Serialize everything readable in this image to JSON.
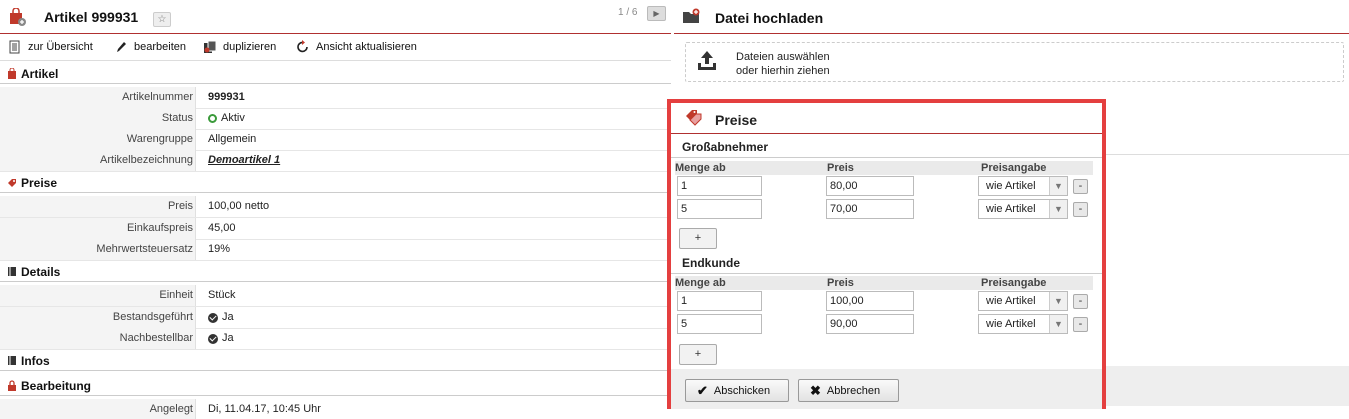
{
  "article": {
    "title": "Artikel 999931",
    "pager": "1 / 6",
    "toolbar": {
      "overview": "zur Übersicht",
      "edit": "bearbeiten",
      "duplicate": "duplizieren",
      "refresh": "Ansicht aktualisieren"
    },
    "sections": {
      "artikel": "Artikel",
      "preise": "Preise",
      "details": "Details",
      "infos": "Infos",
      "bearbeitung": "Bearbeitung"
    },
    "fields": {
      "artikelnummer": {
        "label": "Artikelnummer",
        "value": "999931"
      },
      "status": {
        "label": "Status",
        "value": "Aktiv"
      },
      "warengruppe": {
        "label": "Warengruppe",
        "value": "Allgemein"
      },
      "bezeichnung": {
        "label": "Artikelbezeichnung",
        "value": "Demoartikel 1"
      },
      "preis": {
        "label": "Preis",
        "value": "100,00 netto"
      },
      "einkaufspreis": {
        "label": "Einkaufspreis",
        "value": "45,00"
      },
      "mwst": {
        "label": "Mehrwertsteuersatz",
        "value": "19%"
      },
      "einheit": {
        "label": "Einheit",
        "value": "Stück"
      },
      "bestand": {
        "label": "Bestandsgeführt",
        "value": "Ja"
      },
      "nachbestell": {
        "label": "Nachbestellbar",
        "value": "Ja"
      },
      "angelegt": {
        "label": "Angelegt",
        "value": "Di, 11.04.17, 10:45 Uhr"
      }
    }
  },
  "upload": {
    "title": "Datei hochladen",
    "line1": "Dateien auswählen",
    "line2": "oder hierhin ziehen"
  },
  "prices_dialog": {
    "title": "Preise",
    "headers": {
      "qty": "Menge ab",
      "price": "Preis",
      "mode": "Preisangabe"
    },
    "groups": [
      {
        "name": "Großabnehmer",
        "rows": [
          {
            "qty": "1",
            "price": "80,00",
            "mode": "wie Artikel"
          },
          {
            "qty": "5",
            "price": "70,00",
            "mode": "wie Artikel"
          }
        ]
      },
      {
        "name": "Endkunde",
        "rows": [
          {
            "qty": "1",
            "price": "100,00",
            "mode": "wie Artikel"
          },
          {
            "qty": "5",
            "price": "90,00",
            "mode": "wie Artikel"
          }
        ]
      }
    ],
    "add_label": "+",
    "remove_label": "-",
    "submit": "Abschicken",
    "cancel": "Abbrechen"
  },
  "colors": {
    "accent": "#b03030",
    "highlight": "#e43f3f",
    "active": "#3a9a3a"
  }
}
